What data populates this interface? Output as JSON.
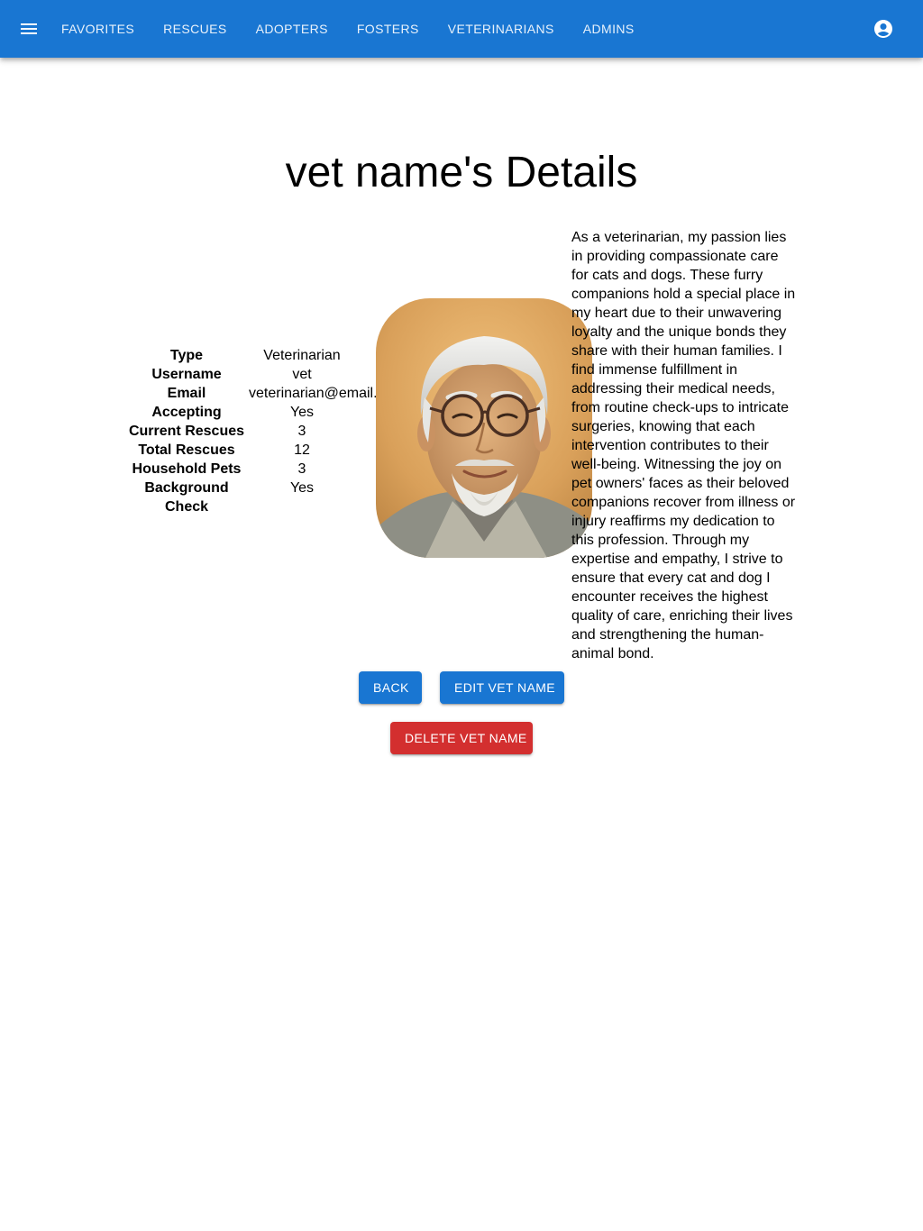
{
  "nav": {
    "items": [
      {
        "label": "Favorites"
      },
      {
        "label": "Rescues"
      },
      {
        "label": "Adopters"
      },
      {
        "label": "Fosters"
      },
      {
        "label": "Veterinarians"
      },
      {
        "label": "Admins"
      }
    ]
  },
  "icons": {
    "menu": "menu-icon",
    "account": "account-circle-icon"
  },
  "colors": {
    "primary": "#1976d2",
    "danger": "#d32f2f"
  },
  "page": {
    "title": "vet name's Details"
  },
  "details": {
    "rows": [
      {
        "label": "Type",
        "value": "Veterinarian"
      },
      {
        "label": "Username",
        "value": "vet"
      },
      {
        "label": "Email",
        "value": "veterinarian@email.com"
      },
      {
        "label": "Accepting",
        "value": "Yes"
      },
      {
        "label": "Current Rescues",
        "value": "3"
      },
      {
        "label": "Total Rescues",
        "value": "12"
      },
      {
        "label": "Household Pets",
        "value": "3"
      },
      {
        "label": "Background Check",
        "value": "Yes"
      }
    ]
  },
  "bio": "As a veterinarian, my passion lies in providing compassionate care for cats and dogs. These furry companions hold a special place in my heart due to their unwavering loyalty and the unique bonds they share with their human families. I find immense fulfillment in addressing their medical needs, from routine check-ups to intricate surgeries, knowing that each intervention contributes to their well-being. Witnessing the joy on pet owners' faces as their beloved companions recover from illness or injury reaffirms my dedication to this profession. Through my expertise and empathy, I strive to ensure that every cat and dog I encounter receives the highest quality of care, enriching their lives and strengthening the human-animal bond.",
  "actions": {
    "back": "Back",
    "edit": "Edit vet name",
    "delete": "Delete vet name"
  }
}
